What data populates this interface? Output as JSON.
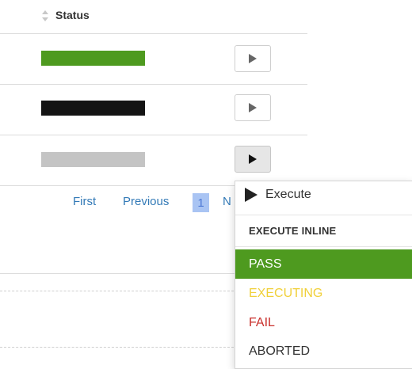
{
  "table": {
    "status_header": "Status",
    "rows": [
      {
        "status_color": "#4e9a1f"
      },
      {
        "status_color": "#141414"
      },
      {
        "status_color": "#c4c4c4"
      }
    ]
  },
  "pagination": {
    "first": "First",
    "previous": "Previous",
    "current_page": "1",
    "next_partial": "N"
  },
  "dropdown": {
    "execute_label": "Execute",
    "inline_header": "EXECUTE INLINE",
    "options": [
      {
        "label": "PASS",
        "color": "#ffffff",
        "background": "#4e9a1f"
      },
      {
        "label": "EXECUTING",
        "color": "#f0d03a",
        "background": "#ffffff"
      },
      {
        "label": "FAIL",
        "color": "#c9302c",
        "background": "#ffffff"
      },
      {
        "label": "ABORTED",
        "color": "#333333",
        "background": "#ffffff"
      }
    ]
  }
}
